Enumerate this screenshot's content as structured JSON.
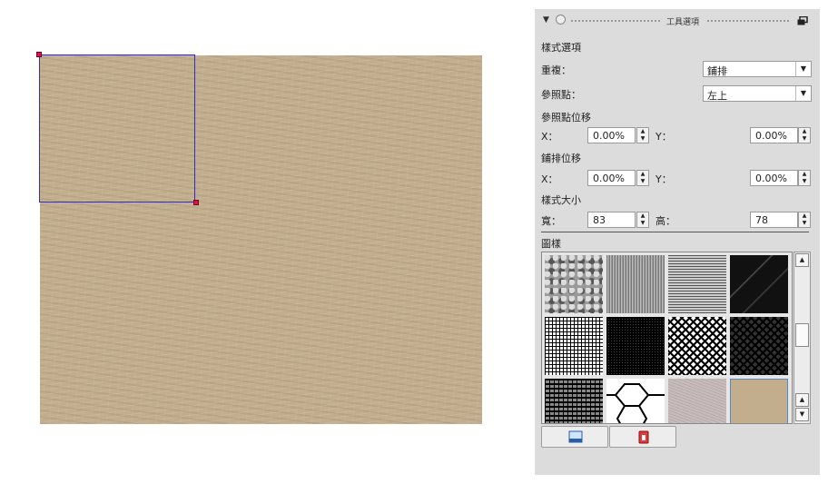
{
  "panel": {
    "title": "工具選項"
  },
  "options": {
    "pattern_options_label": "樣式選項",
    "repeat_label": "重複：",
    "repeat_value": "鋪排",
    "ref_point_label": "參照點：",
    "ref_point_value": "左上",
    "ref_offset_label": "參照點位移",
    "ref_x_label": "X：",
    "ref_x_value": "0.00%",
    "ref_y_label": "Y：",
    "ref_y_value": "0.00%",
    "tile_offset_label": "鋪排位移",
    "tile_x_label": "X：",
    "tile_x_value": "0.00%",
    "tile_y_label": "Y：",
    "tile_y_value": "0.00%",
    "size_label": "樣式大小",
    "width_label": "寬：",
    "width_value": "83",
    "height_label": "高：",
    "height_value": "78",
    "pattern_label": "圖樣"
  },
  "patterns": [
    {
      "name": "granite"
    },
    {
      "name": "fine-noise"
    },
    {
      "name": "horizontal-lines"
    },
    {
      "name": "black-marble"
    },
    {
      "name": "grid-fine"
    },
    {
      "name": "grid-dense"
    },
    {
      "name": "diamond-mesh"
    },
    {
      "name": "diamond-mesh-dark"
    },
    {
      "name": "grid-stripes"
    },
    {
      "name": "hexagons"
    },
    {
      "name": "pink-noise"
    },
    {
      "name": "sand",
      "selected": true
    }
  ],
  "icons": {
    "collapse": "triangle-down-icon",
    "tool": "circle-icon",
    "detach": "detach-window-icon",
    "import": "import-pattern-icon",
    "delete": "delete-pattern-icon"
  },
  "colors": {
    "canvas_texture": "#c2ae8c",
    "selection_border": "#2c2cd0",
    "handle": "#e0104a",
    "panel_bg": "#dcdcdc"
  }
}
